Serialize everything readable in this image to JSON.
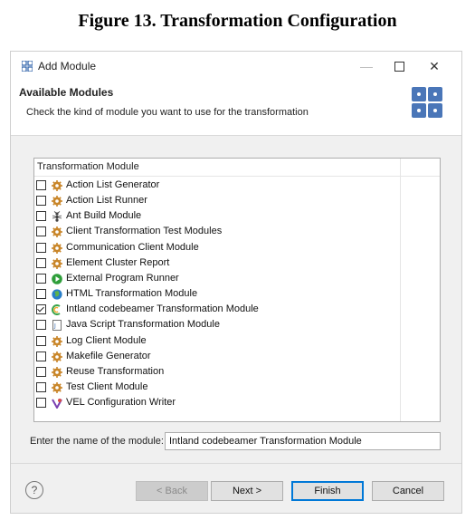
{
  "caption": "Figure 13. Transformation Configuration",
  "window": {
    "title": "Add Module",
    "controls": {
      "minimize": "—",
      "maximize": "",
      "close": "✕"
    }
  },
  "header": {
    "title": "Available Modules",
    "description": "Check the kind of module you want to use for the transformation"
  },
  "module_list": {
    "column_header": "Transformation Module",
    "items": [
      {
        "label": "Action List Generator",
        "checked": false,
        "icon": "gear-icon"
      },
      {
        "label": "Action List Runner",
        "checked": false,
        "icon": "gear-icon"
      },
      {
        "label": "Ant Build Module",
        "checked": false,
        "icon": "ant-icon"
      },
      {
        "label": "Client Transformation Test Modules",
        "checked": false,
        "icon": "gear-icon"
      },
      {
        "label": "Communication Client Module",
        "checked": false,
        "icon": "gear-icon"
      },
      {
        "label": "Element Cluster Report",
        "checked": false,
        "icon": "gear-icon"
      },
      {
        "label": "External Program Runner",
        "checked": false,
        "icon": "play-icon"
      },
      {
        "label": "HTML Transformation Module",
        "checked": false,
        "icon": "globe-icon"
      },
      {
        "label": "Intland codebeamer Transformation Module",
        "checked": true,
        "icon": "codebeamer-icon"
      },
      {
        "label": "Java Script Transformation Module",
        "checked": false,
        "icon": "script-icon"
      },
      {
        "label": "Log Client Module",
        "checked": false,
        "icon": "gear-icon"
      },
      {
        "label": "Makefile Generator",
        "checked": false,
        "icon": "gear-icon"
      },
      {
        "label": "Reuse Transformation",
        "checked": false,
        "icon": "gear-icon"
      },
      {
        "label": "Test Client Module",
        "checked": false,
        "icon": "gear-icon"
      },
      {
        "label": "VEL Configuration Writer",
        "checked": false,
        "icon": "vel-icon"
      }
    ]
  },
  "module_name": {
    "label": "Enter the name of the module:",
    "value": "Intland codebeamer Transformation Module"
  },
  "buttons": {
    "help": "?",
    "back": "< Back",
    "next": "Next >",
    "finish": "Finish",
    "cancel": "Cancel"
  },
  "colors": {
    "accent": "#0078d7",
    "gear": "#c9862a",
    "play": "#2e9e3a",
    "globe": "#2a7fc9"
  }
}
